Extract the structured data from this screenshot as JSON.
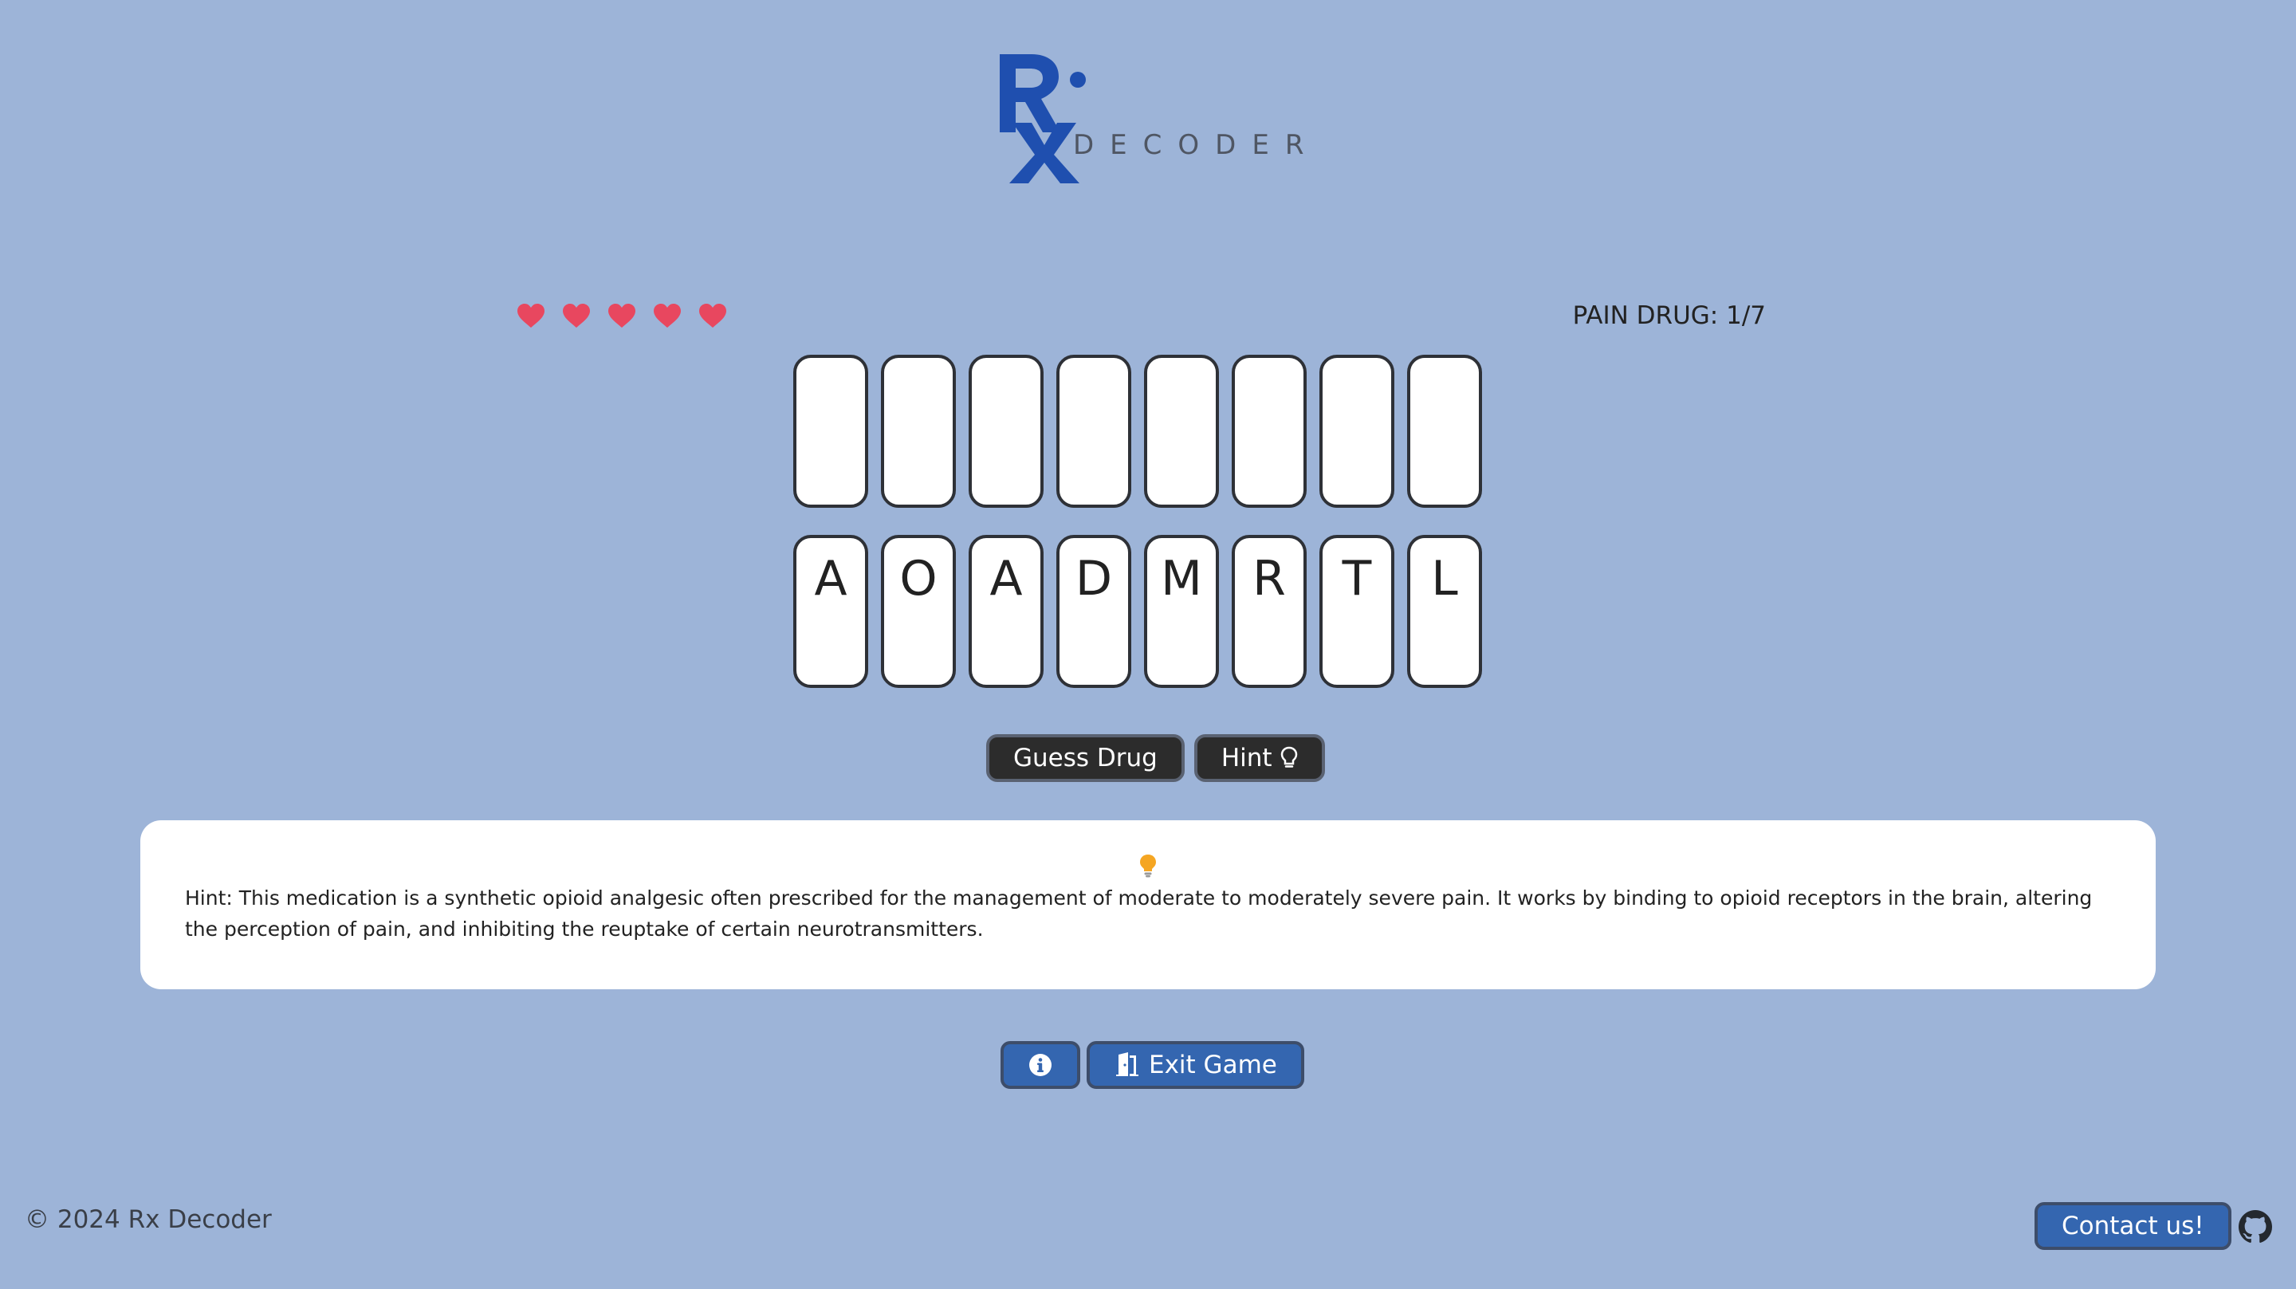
{
  "logo": {
    "mark": "Rx",
    "word": "DECODER",
    "color": "#1f4faf"
  },
  "lives": {
    "count": 5,
    "max": 5,
    "color": "#e8475f",
    "icon": "heart-icon"
  },
  "progress": {
    "text": "PAIN DRUG: 1/7"
  },
  "answer_slots": [
    "",
    "",
    "",
    "",
    "",
    "",
    "",
    ""
  ],
  "scrambled_letters": [
    "A",
    "O",
    "A",
    "D",
    "M",
    "R",
    "T",
    "L"
  ],
  "actions": {
    "guess_label": "Guess Drug",
    "hint_label": "Hint",
    "hint_icon": "lightbulb-outline-icon"
  },
  "hint_panel": {
    "icon": "lightbulb-icon",
    "text": "Hint: This medication is a synthetic opioid analgesic often prescribed for the management of moderate to moderately severe pain. It works by binding to opioid receptors in the brain, altering the perception of pain, and inhibiting the reuptake of certain neurotransmitters."
  },
  "bottom_actions": {
    "info_icon": "info-icon",
    "exit_label": "Exit Game",
    "exit_icon": "door-exit-icon"
  },
  "footer": {
    "copyright": "© 2024 Rx Decoder",
    "contact_label": "Contact us!",
    "github_icon": "github-icon"
  },
  "colors": {
    "background": "#9db4d8",
    "button_dark": "#2c2c2c",
    "button_blue": "#3466b0",
    "bulb": "#f5a623"
  }
}
